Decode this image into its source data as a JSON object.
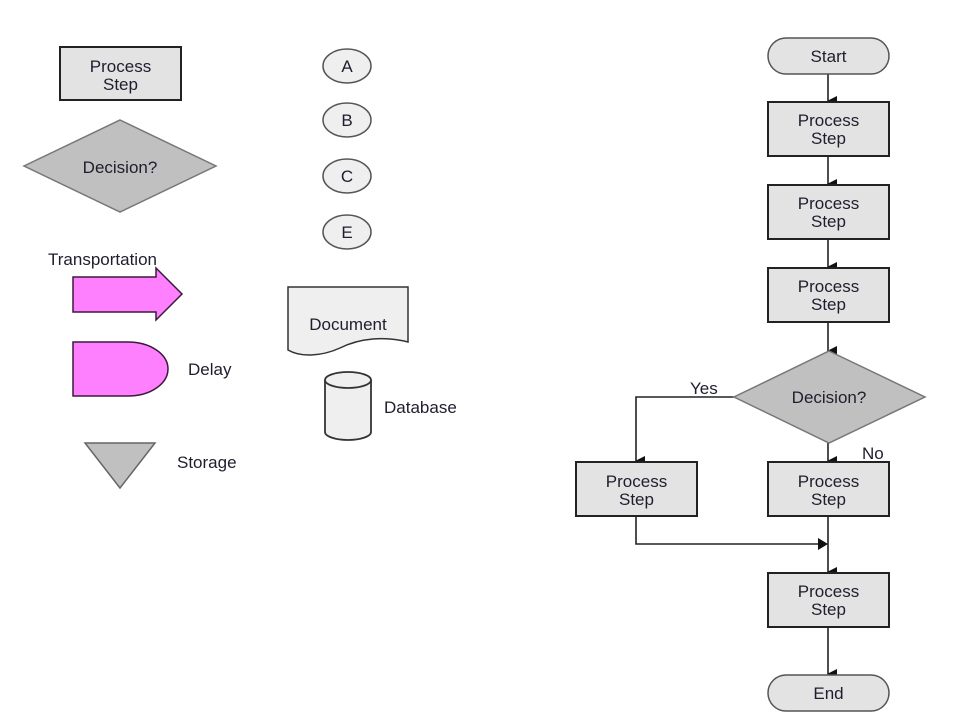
{
  "legend": {
    "process": "Process Step",
    "process_lines": [
      "Process",
      "Step"
    ],
    "decision": "Decision?",
    "connectors": [
      "A",
      "B",
      "C",
      "E"
    ],
    "transportation": "Transportation",
    "delay": "Delay",
    "storage": "Storage",
    "document": "Document",
    "database": "Database"
  },
  "flow": {
    "start": "Start",
    "steps": [
      [
        "Process",
        "Step"
      ],
      [
        "Process",
        "Step"
      ],
      [
        "Process",
        "Step"
      ]
    ],
    "decision": "Decision?",
    "yes_label": "Yes",
    "no_label": "No",
    "yes_step": [
      "Process",
      "Step"
    ],
    "no_step": [
      "Process",
      "Step"
    ],
    "final_step": [
      "Process",
      "Step"
    ],
    "end": "End"
  },
  "colors": {
    "pink_fill": "#ff80ff",
    "gray_fill": "#c0c0c0",
    "box_fill": "#e3e3e3"
  }
}
